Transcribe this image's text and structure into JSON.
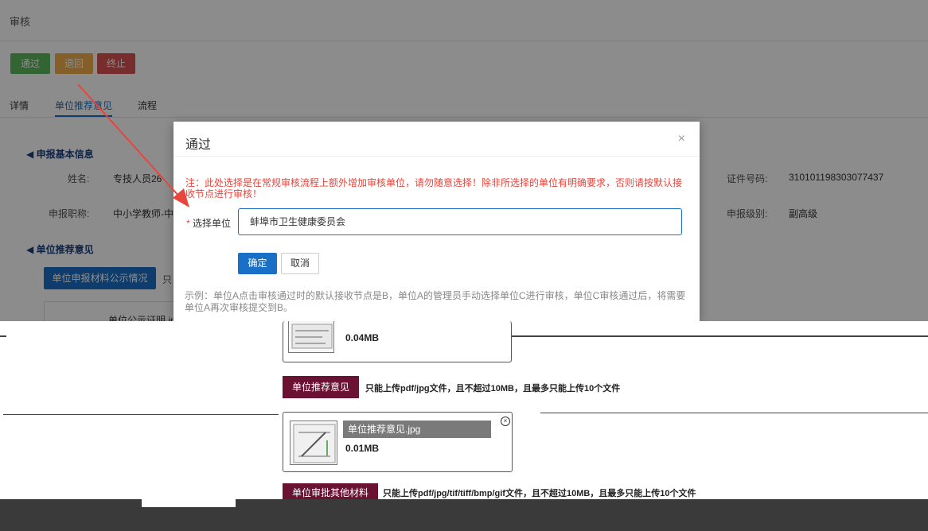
{
  "header": {
    "title": "审核"
  },
  "actions": {
    "pass": "通过",
    "return": "退回",
    "stop": "终止"
  },
  "tabs": [
    {
      "label": "详情"
    },
    {
      "label": "单位推荐意见"
    },
    {
      "label": "流程"
    }
  ],
  "basic_info": {
    "title": "申报基本信息",
    "name_label": "姓名:",
    "name_value": "专技人员26",
    "title_label": "申报职称:",
    "title_value": "中小学教师-中学",
    "id_label": "证件号码:",
    "id_value": "310101198303077437",
    "level_label": "申报级别:",
    "level_value": "副高级"
  },
  "recommend": {
    "title": "单位推荐意见",
    "materials_button": "单位申报材料公示情况",
    "truncated_hint": "只",
    "file_partial": "单位公示证明.jp"
  },
  "dialog": {
    "title": "通过",
    "close": "×",
    "warning": "注：此处选择是在常规审核流程上额外增加审核单位，请勿随意选择！除非所选择的单位有明确要求，否则请按默认接收节点进行审核！",
    "select_label": "选择单位",
    "select_value": "蚌埠市卫生健康委员会",
    "confirm": "确定",
    "cancel": "取消",
    "example": "示例：单位A点击审核通过时的默认接收节点是B，单位A的管理员手动选择单位C进行审核，单位C审核通过后，将需要单位A再次审核提交到B。"
  },
  "lower": {
    "file1_size": "0.04MB",
    "rec_button": "单位推荐意见",
    "rec_hint": "只能上传pdf/jpg文件，且不超过10MB，且最多只能上传10个文件",
    "file2_name": "单位推荐意见.jpg",
    "file2_size": "0.01MB",
    "other_button": "单位审批其他材料",
    "other_hint": "只能上传pdf/jpg/tif/tiff/bmp/gif文件，且不超过10MB，且最多只能上传10个文件"
  }
}
